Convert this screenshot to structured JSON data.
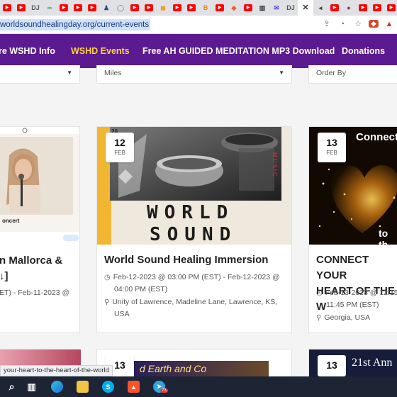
{
  "browser": {
    "tabs": [
      {
        "icon": "youtube-icon",
        "color": "#ff0000",
        "glyph": "▶"
      },
      {
        "icon": "youtube-icon",
        "color": "#ff0000",
        "glyph": "▶"
      },
      {
        "icon": "dj-icon",
        "color": "#555555",
        "glyph": "DJ"
      },
      {
        "icon": "link-icon",
        "color": "#3a9e5a",
        "glyph": "∞"
      },
      {
        "icon": "youtube-icon",
        "color": "#ff0000",
        "glyph": "▶"
      },
      {
        "icon": "youtube-icon",
        "color": "#ff0000",
        "glyph": "▶"
      },
      {
        "icon": "youtube-icon",
        "color": "#ff0000",
        "glyph": "▶"
      },
      {
        "icon": "person-icon",
        "color": "#334488",
        "glyph": "♟"
      },
      {
        "icon": "ring-icon",
        "color": "#999999",
        "glyph": "◯"
      },
      {
        "icon": "youtube-icon",
        "color": "#ff0000",
        "glyph": "▶"
      },
      {
        "icon": "youtube-icon",
        "color": "#ff0000",
        "glyph": "▶"
      },
      {
        "icon": "orange-icon",
        "color": "#f0a030",
        "glyph": "◼"
      },
      {
        "icon": "youtube-icon",
        "color": "#ff0000",
        "glyph": "▶"
      },
      {
        "icon": "youtube-icon",
        "color": "#ff0000",
        "glyph": "▶"
      },
      {
        "icon": "blogger-icon",
        "color": "#f57d00",
        "glyph": "B"
      },
      {
        "icon": "youtube-icon",
        "color": "#ff0000",
        "glyph": "▶"
      },
      {
        "icon": "brave-icon",
        "color": "#fb542b",
        "glyph": "◆"
      },
      {
        "icon": "youtube-icon",
        "color": "#ff0000",
        "glyph": "▶"
      },
      {
        "icon": "book-icon",
        "color": "#333333",
        "glyph": "▥"
      },
      {
        "icon": "mail-icon",
        "color": "#5a4fcf",
        "glyph": "✉"
      },
      {
        "icon": "dj-icon",
        "color": "#555555",
        "glyph": "DJ"
      },
      {
        "icon": "close-icon",
        "color": "#333333",
        "glyph": "✕",
        "active": true
      },
      {
        "icon": "speaker-icon",
        "color": "#444444",
        "glyph": "◂"
      },
      {
        "icon": "youtube-icon",
        "color": "#ff0000",
        "glyph": "▶"
      },
      {
        "icon": "avatar-icon",
        "color": "#884422",
        "glyph": "●"
      },
      {
        "icon": "youtube-icon",
        "color": "#ff0000",
        "glyph": "▶"
      },
      {
        "icon": "youtube-icon",
        "color": "#ff0000",
        "glyph": "▶"
      },
      {
        "icon": "youtube-icon",
        "color": "#ff0000",
        "glyph": "▶"
      }
    ],
    "url": "worldsoundhealingday.org/current-events",
    "status_url": "your-heart-to-the-heart-of-the-world"
  },
  "nav": {
    "items": [
      "re WSHD Info",
      "WSHD Events",
      "Free AH GUIDED MEDITATION MP3 Download",
      "Donations"
    ],
    "active_color": "#ffd43b",
    "bg_color": "#5b1a8f"
  },
  "filters": {
    "distance": "Miles",
    "order": "Order By"
  },
  "cards": [
    {
      "title_line1": "n Mallorca &",
      "title_line2": "↓]",
      "meta_line1": "ET) - Feb-11-2023 @",
      "thumb_caption": "oncert"
    },
    {
      "day": "12",
      "month": "FEB",
      "title": "World Sound Healing Immersion",
      "date_line1": "Feb-12-2023 @ 03:00 PM (EST) - Feb-12-2023 @",
      "date_line2": "04:00 PM (EST)",
      "loc_line1": "Unity of Lawrence, Madeline Lane, Lawrence, KS,",
      "loc_line2": "USA",
      "thumb_word1": "WORLD",
      "thumb_word2": "SOUND",
      "thumb_side": "MUSIC",
      "thumb_top": "20"
    },
    {
      "day": "13",
      "month": "FEB",
      "title_line1": "CONNECT YOUR",
      "title_line2": "HEART OF THE W",
      "date_line1": "Feb-13-2023 @ 12:15",
      "date_line2": "11:45 PM (EST)",
      "loc_line1": "Georgia, USA",
      "thumb_title": "Connect",
      "thumb_sub": "to th"
    }
  ],
  "row2": {
    "card2_day": "13",
    "card2_banner": "d Earth and Co",
    "card3_day": "13",
    "card3_title": "21st Ann"
  },
  "taskbar": {
    "icons": [
      "search-icon",
      "taskview-icon",
      "edge-icon",
      "files-icon",
      "skype-icon",
      "brave-icon",
      "telegram-icon"
    ],
    "telegram_badge": "73"
  }
}
